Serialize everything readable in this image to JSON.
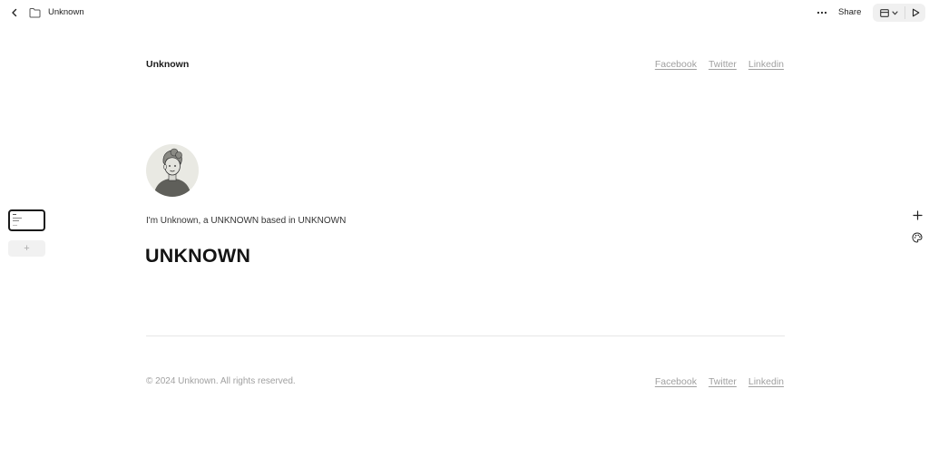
{
  "topbar": {
    "document_title": "Unknown",
    "share_label": "Share",
    "icons": {
      "back": "chevron-left-icon",
      "folder": "folder-icon",
      "more": "more-horizontal-icon",
      "layout": "layout-icon",
      "layout_dropdown": "chevron-down-icon",
      "play": "play-icon"
    }
  },
  "page_rail": {
    "add_page_icon": "+"
  },
  "right_tools": {
    "add_icon": "plus-icon",
    "palette_icon": "palette-icon"
  },
  "page": {
    "site_name": "Unknown",
    "nav_links": [
      "Facebook",
      "Twitter",
      "Linkedin"
    ],
    "intro": "I'm Unknown, a UNKNOWN based in UNKNOWN",
    "headline": "UNKNOWN",
    "footer": {
      "copyright": "© 2024 Unknown. All rights reserved.",
      "links": [
        "Facebook",
        "Twitter",
        "Linkedin"
      ]
    }
  },
  "colors": {
    "text": "#1a1a1a",
    "muted": "#a0a0a0",
    "avatar_bg": "#e9e9e3",
    "divider": "#e6e6e6"
  }
}
